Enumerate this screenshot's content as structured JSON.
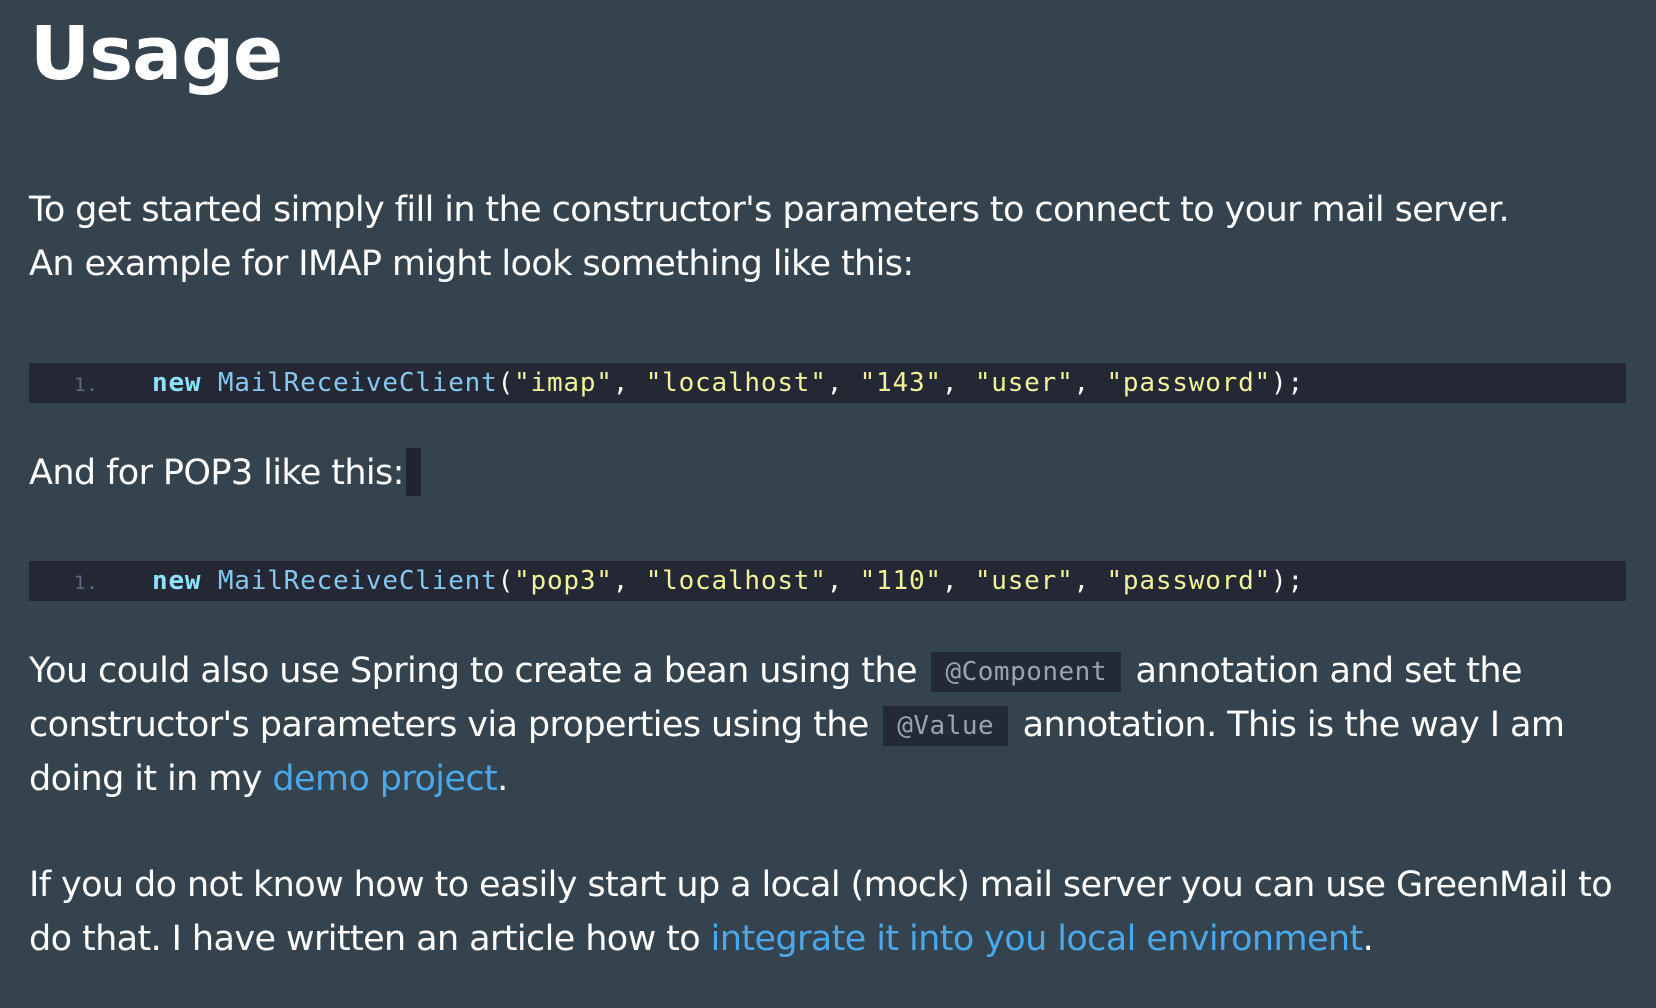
{
  "title": "Usage",
  "intro": {
    "line1": "To get started simply fill in the constructor's parameters to connect to your mail server.",
    "line2": "An example for IMAP might look something like this:"
  },
  "code_imap": {
    "line_number": "1.",
    "keyword": "new",
    "class_name": "MailReceiveClient",
    "open": "(",
    "args": [
      "\"imap\"",
      "\"localhost\"",
      "\"143\"",
      "\"user\"",
      "\"password\""
    ],
    "separator": ", ",
    "close": ");"
  },
  "pop3_intro": "And for POP3 like this:",
  "code_pop3": {
    "line_number": "1.",
    "keyword": "new",
    "class_name": "MailReceiveClient",
    "open": "(",
    "args": [
      "\"pop3\"",
      "\"localhost\"",
      "\"110\"",
      "\"user\"",
      "\"password\""
    ],
    "separator": ", ",
    "close": ");"
  },
  "spring": {
    "line1_before": "You could also use Spring to create a bean using the ",
    "component_code": "@Component",
    "line1_after": " annotation and set the",
    "line2_before": "constructor's parameters via properties using the ",
    "value_code": "@Value",
    "line2_after": " annotation. This is the way I am",
    "line3_before": "doing it in my ",
    "link_text": "demo project",
    "line3_after": "."
  },
  "greenmail": {
    "line1": "If you do not know how to easily start up a local (mock) mail server you can use GreenMail to",
    "line2_before": "do that. I have written an article how to ",
    "link_text": "integrate it into you local environment",
    "line2_after": "."
  },
  "colors": {
    "background": "#34434d",
    "code_background": "#232834",
    "link": "#4aa8ea",
    "keyword": "#8fe1ff",
    "class_name": "#87c6ee",
    "string": "#f1f29b"
  }
}
